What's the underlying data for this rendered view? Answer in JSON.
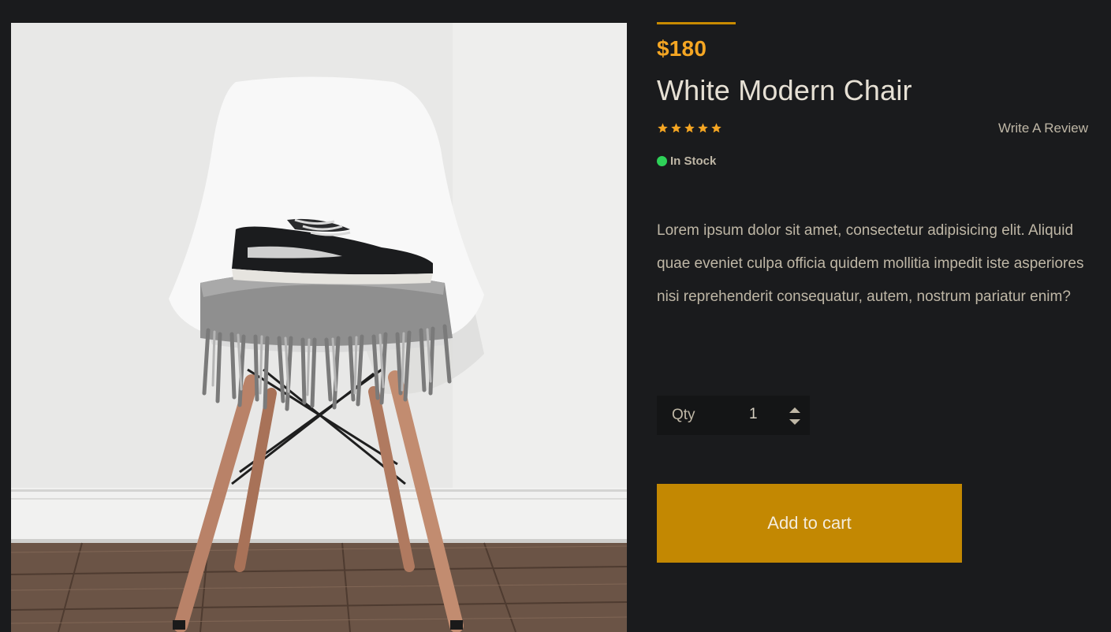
{
  "product": {
    "price": "$180",
    "title": "White Modern Chair",
    "rating": {
      "value": 5,
      "max": 5
    },
    "review_link": "Write A Review",
    "stock_status": "In Stock",
    "description": "Lorem ipsum dolor sit amet, consectetur adipisicing elit. Aliquid quae eveniet culpa officia quidem mollitia impedit iste asperiores nisi reprehenderit consequatur, autem, nostrum pariatur enim?"
  },
  "quantity": {
    "label": "Qty",
    "value": "1"
  },
  "actions": {
    "add_to_cart": "Add to cart"
  },
  "colors": {
    "background": "#1a1b1d",
    "accent": "#c38802",
    "price": "#f5a623",
    "in_stock": "#2ed158"
  },
  "icons": {
    "rating": "star-icon",
    "stock": "status-dot-icon",
    "qty_up": "caret-up-icon",
    "qty_down": "caret-down-icon"
  }
}
